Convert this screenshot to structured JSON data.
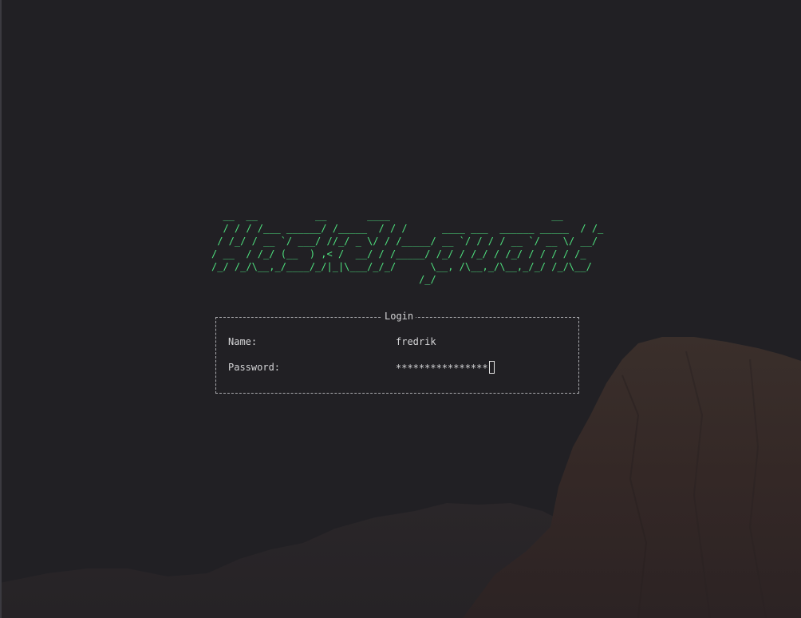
{
  "logo": {
    "ascii_lines": [
      "  __  __          __       ____                            __",
      "  / / / /___ ______/ /_____  / / /      ____ ___  ______ _____  / /_",
      " / /_/ / __ `/ ___/ //_/ _ \\/ / /_____/ __ `/ / / / __ `/ __ \\/ __/",
      "/ __  / /_/ (__  ) ,< /  __/ / /_____/ /_/ / /_/ / /_/ / / / / /_",
      "/_/ /_/\\__,_/____/_/|_|\\___/_/_/      \\__, /\\__,_/\\__,_/_/ /_/\\__/",
      "                                    /_/"
    ],
    "color": "#4ee07e"
  },
  "login": {
    "title": "Login",
    "name_label": "Name:",
    "name_value": "fredrik",
    "password_label": "Password:",
    "password_value": "****************"
  },
  "colors": {
    "background": "#212024",
    "text": "#d4d4d6",
    "border": "#a9a9ad"
  }
}
